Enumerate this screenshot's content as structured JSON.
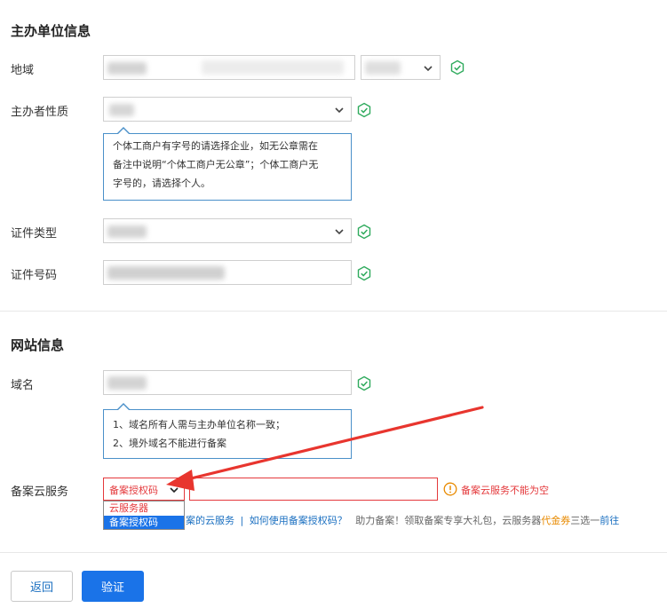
{
  "sponsor_section": {
    "title": "主办单位信息",
    "region_label": "地域",
    "sponsor_type_label": "主办者性质",
    "sponsor_type_tip": [
      "个体工商户有字号的请选择企业，如无公章需在",
      "备注中说明“个体工商户无公章”；个体工商户无",
      "字号的，请选择个人。"
    ],
    "id_type_label": "证件类型",
    "id_number_label": "证件号码"
  },
  "website_section": {
    "title": "网站信息",
    "domain_label": "域名",
    "domain_tip": [
      "1、域名所有人需与主办单位名称一致；",
      "2、境外域名不能进行备案"
    ],
    "cloud_service_label": "备案云服务",
    "cloud_service_selected": "备案授权码",
    "cloud_service_options": [
      "云服务器",
      "备案授权码"
    ],
    "cloud_service_error": "备案云服务不能为空",
    "help_line": {
      "prefix": "案的云服务",
      "separator": "|",
      "how_to_link": "如何使用备案授权码？",
      "promo_text": "助力备案！领取备案专享大礼包，云服务器",
      "promo_highlight": "代金券",
      "promo_suffix": "三选一",
      "go_link": "前往"
    }
  },
  "buttons": {
    "back": "返回",
    "verify": "验证"
  },
  "colors": {
    "primary": "#1a73e8",
    "success": "#2eaa5c",
    "error": "#e4393c",
    "link": "#1a6fc0",
    "highlight": "#e88a00"
  }
}
